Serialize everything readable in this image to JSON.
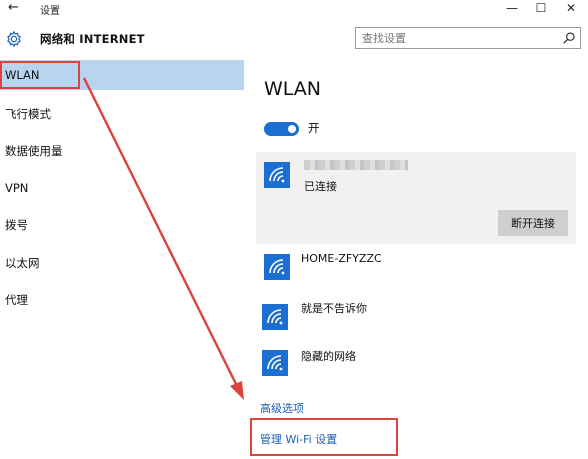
{
  "window": {
    "back_glyph": "←",
    "title": "设置",
    "minimize_glyph": "—",
    "maximize_glyph": "☐",
    "close_glyph": "✕"
  },
  "header": {
    "section_title": "网络和 INTERNET",
    "search_placeholder": "查找设置"
  },
  "sidebar": {
    "items": [
      {
        "label": "WLAN",
        "selected": true
      },
      {
        "label": "飞行模式"
      },
      {
        "label": "数据使用量"
      },
      {
        "label": "VPN"
      },
      {
        "label": "拨号"
      },
      {
        "label": "以太网"
      },
      {
        "label": "代理"
      }
    ]
  },
  "main": {
    "title": "WLAN",
    "toggle": {
      "label": "开",
      "on": true
    },
    "connected_network": {
      "status": "已连接",
      "disconnect_label": "断开连接"
    },
    "networks": [
      {
        "name": "HOME-ZFYZZC"
      },
      {
        "name": "就是不告诉你"
      },
      {
        "name": "隐藏的网络"
      }
    ],
    "advanced_link": "高级选项",
    "manage_wifi_link": "管理 Wi-Fi 设置"
  },
  "colors": {
    "accent": "#1a6fd0",
    "selected_nav": "#b8d4ee",
    "annotation_red": "#d9443f",
    "link": "#1a5fb4"
  },
  "icons": {
    "settings": "gear-icon",
    "search": "search-icon",
    "wifi": "wifi-icon"
  }
}
